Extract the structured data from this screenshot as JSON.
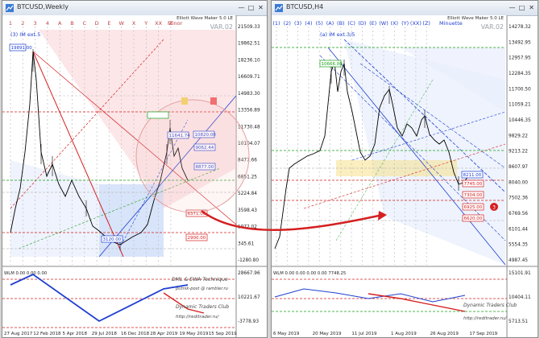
{
  "windows": [
    {
      "title": "BTCUSD,Weekly",
      "indicator_label": "Elliott Wave Maker 5.0 LE",
      "var_label": "VAR.02",
      "wave_header": "(3) IM ext.5",
      "degree_label": "Minor",
      "grid_letters": [
        "1",
        "2",
        "3",
        "4",
        "A",
        "B",
        "C",
        "D",
        "E",
        "W",
        "X",
        "Y",
        "XX",
        "Z"
      ],
      "prices": [
        "21509.33",
        "19862.51",
        "18236.10",
        "16609.71",
        "14983.30",
        "13356.89",
        "11730.48",
        "10104.07",
        "8477.66",
        "6851.25",
        "5224.84",
        "3598.43",
        "1972.02",
        "345.61",
        "-1280.80"
      ],
      "sub_prices": [
        "28667.96",
        "10221.67",
        "-3778.93"
      ],
      "dates": [
        "27 Aug 2017",
        "12 Feb 2018",
        "5 Apr 2018",
        "29 Jul 2018",
        "16 Dec 2018",
        "28 Apr 2019",
        "19 May 2019",
        "15 Sep 2019"
      ],
      "boxes": [
        "19891.00",
        "11641.74",
        "10820.00",
        "9062.44",
        "8877.00",
        "6371.00",
        "3120.00",
        "2900.00"
      ],
      "sub_label": "WLM 0.00 0.00 0.00",
      "credits": [
        "DML & EWA Technique",
        "putnik-post @ rambler.ru",
        "Dynamic Traders Club",
        "http://reditrader.ru/"
      ]
    },
    {
      "title": "BTCUSD,H4",
      "indicator_label": "Elliott Wave Maker 5.0 LE",
      "var_label": "VAR.02",
      "wave_header": "(a) IM ext.3/5",
      "degree_label": "Minuette",
      "grid_letters": [
        "(1)",
        "(2)",
        "(3)",
        "(4)",
        "(5)",
        "(A)",
        "(B)",
        "(C)",
        "(D)",
        "(E)",
        "(W)",
        "(X)",
        "(Y)",
        "(XX)",
        "(Z)"
      ],
      "prices": [
        "14278.32",
        "13492.95",
        "12957.95",
        "12284.35",
        "11700.50",
        "11059.21",
        "10446.35",
        "9829.22",
        "9213.22",
        "8607.97",
        "8040.00",
        "7502.36",
        "6769.56",
        "6101.44",
        "5554.35",
        "4987.45"
      ],
      "sub_prices": [
        "15101.91",
        "10404.11",
        "5713.51"
      ],
      "dates": [
        "6 May 2019",
        "20 May 2019",
        "11 Jul 2019",
        "1 Aug 2019",
        "26 Aug 2019",
        "17 Sep 2019"
      ],
      "boxes": [
        "10666.00",
        "8211.00",
        "7745.00",
        "7304.00",
        "6925.00",
        "6620.00"
      ],
      "sub_label": "WLM 0.00 0.00 0.00 0.00 7748.25",
      "credits": [
        "Dynamic Traders Club",
        "http://reditrader.ru/"
      ],
      "marker": "3"
    }
  ],
  "colors": {
    "red": "#d42020",
    "blue": "#1e3fd0",
    "green": "#1aa01a",
    "grid": "#c0c0c0",
    "pink_fill": "#f8c8cc",
    "blue_fill": "#c8d8f8"
  }
}
